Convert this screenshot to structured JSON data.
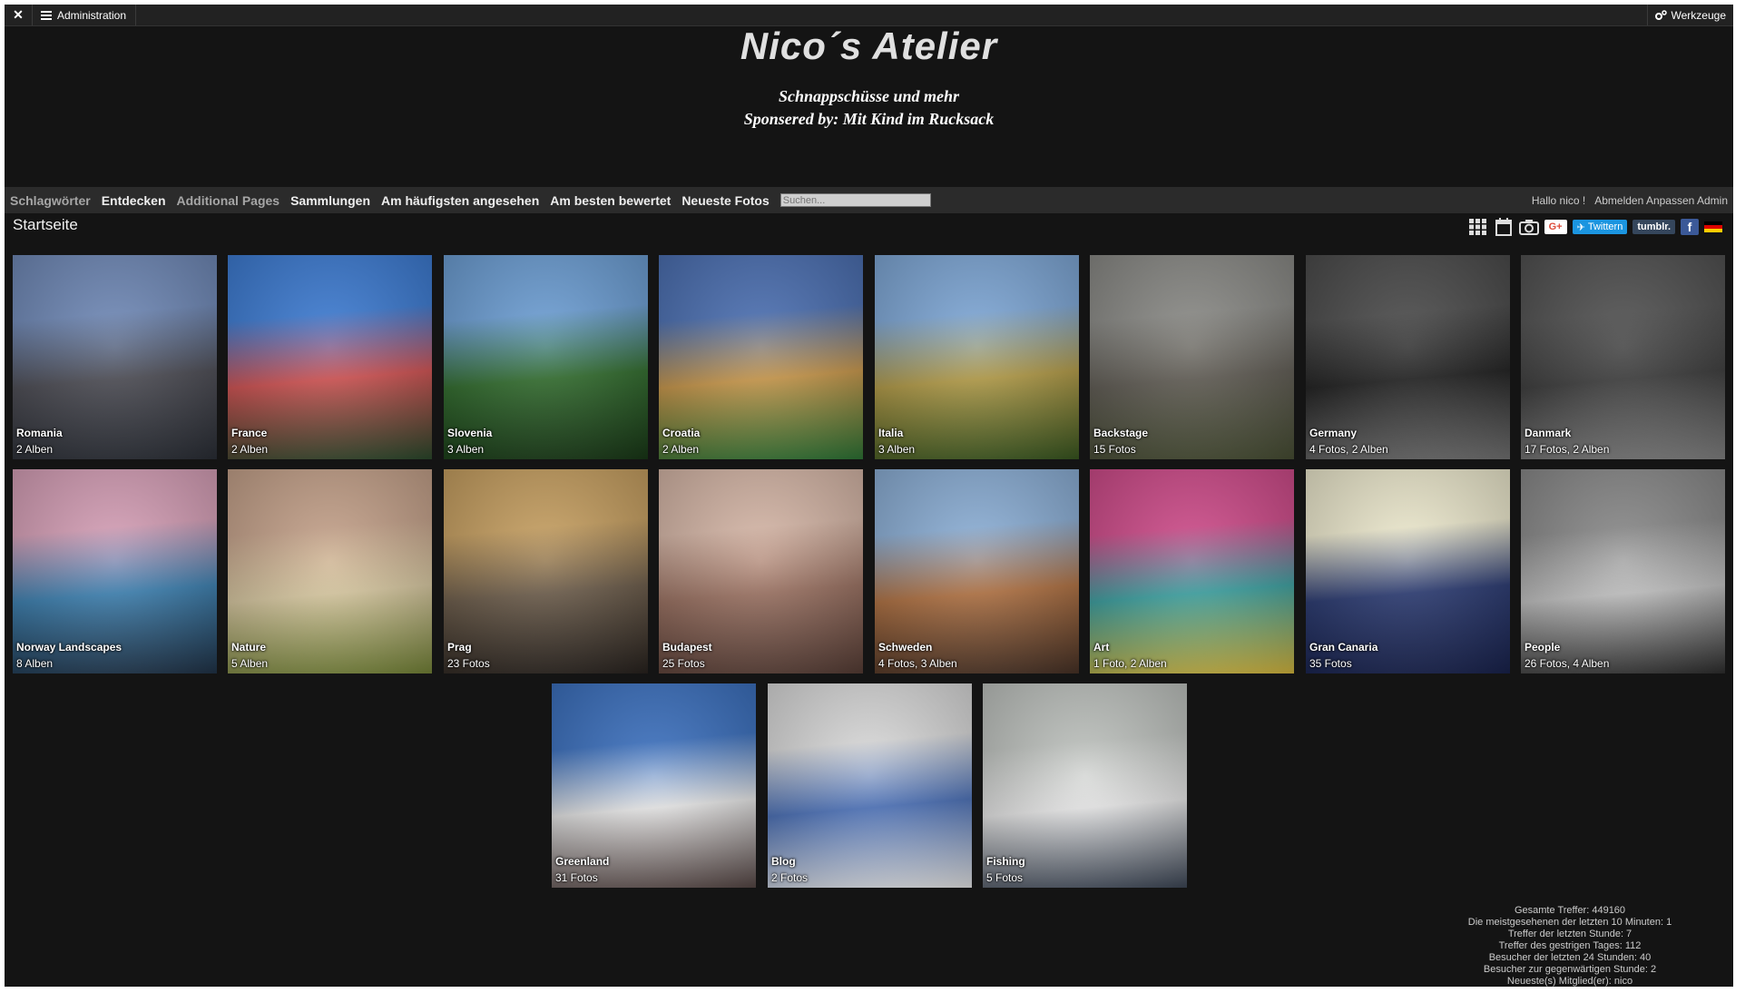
{
  "adminbar": {
    "close_label": "✕",
    "admin_label": "Administration",
    "tools_label": "Werkzeuge"
  },
  "header": {
    "title": "Nico´s Atelier",
    "subtitle_line1": "Schnappschüsse und mehr",
    "subtitle_line2": "Sponsered by: Mit Kind im Rucksack"
  },
  "menu": {
    "items": [
      {
        "label": "Schlagwörter",
        "dim": true
      },
      {
        "label": "Entdecken",
        "dim": false
      },
      {
        "label": "Additional Pages",
        "dim": true
      },
      {
        "label": "Sammlungen",
        "dim": false
      },
      {
        "label": "Am häufigsten angesehen",
        "dim": false
      },
      {
        "label": "Am besten bewertet",
        "dim": false
      },
      {
        "label": "Neueste Fotos",
        "dim": false
      }
    ],
    "search_placeholder": "Suchen...",
    "greeting": "Hallo nico !",
    "user_links": "Abmelden Anpassen Admin"
  },
  "page": {
    "title": "Startseite"
  },
  "toolbar": {
    "gplus": "G+",
    "twitter": "Twittern",
    "tumblr": "tumblr.",
    "facebook": "f"
  },
  "albums": [
    {
      "name": "Romania",
      "count": "2 Alben",
      "colors": [
        "#6f89b8",
        "#4a4a52",
        "#2c3038"
      ]
    },
    {
      "name": "France",
      "count": "2 Alben",
      "colors": [
        "#3b7bd4",
        "#d05050",
        "#2d4d2e"
      ]
    },
    {
      "name": "Slovenia",
      "count": "3 Alben",
      "colors": [
        "#6c9fd6",
        "#2f6b2b",
        "#1a3a18"
      ]
    },
    {
      "name": "Croatia",
      "count": "2 Alben",
      "colors": [
        "#4a6fb3",
        "#c89648",
        "#2f7a38"
      ]
    },
    {
      "name": "Italia",
      "count": "3 Alben",
      "colors": [
        "#7ea8d8",
        "#b29a45",
        "#3b5b22"
      ]
    },
    {
      "name": "Backstage",
      "count": "15 Fotos",
      "colors": [
        "#8a8a86",
        "#5e5a52",
        "#4b5236"
      ]
    },
    {
      "name": "Germany",
      "count": "4 Fotos, 2 Alben",
      "colors": [
        "#4a4a4a",
        "#1e1e1e",
        "#7a7a7a"
      ]
    },
    {
      "name": "Danmark",
      "count": "17 Fotos, 2 Alben",
      "colors": [
        "#505050",
        "#3a3a3a",
        "#8a8a8a"
      ]
    },
    {
      "name": "Norway Landscapes",
      "count": "8 Alben",
      "colors": [
        "#d8a0b8",
        "#3a7fb0",
        "#22354a"
      ]
    },
    {
      "name": "Nature",
      "count": "5 Alben",
      "colors": [
        "#c6a28a",
        "#d8c8a0",
        "#7a8a3a"
      ]
    },
    {
      "name": "Prag",
      "count": "23 Fotos",
      "colors": [
        "#c8a060",
        "#6a5a48",
        "#2a2420"
      ]
    },
    {
      "name": "Budapest",
      "count": "25 Fotos",
      "colors": [
        "#d8b8a8",
        "#9a7060",
        "#5a4038"
      ]
    },
    {
      "name": "Schweden",
      "count": "4 Fotos, 3 Alben",
      "colors": [
        "#8cb0d8",
        "#b07040",
        "#4a3428"
      ]
    },
    {
      "name": "Art",
      "count": "1 Foto, 2 Alben",
      "colors": [
        "#d04a8a",
        "#3aa0a0",
        "#e0c040"
      ]
    },
    {
      "name": "Gran Canaria",
      "count": "35 Fotos",
      "colors": [
        "#f0ecd0",
        "#283870",
        "#1a2450"
      ]
    },
    {
      "name": "People",
      "count": "26 Fotos, 4 Alben",
      "colors": [
        "#8a8a8a",
        "#c0c0c0",
        "#303030"
      ]
    },
    {
      "name": "Greenland",
      "count": "31 Fotos",
      "colors": [
        "#3a70c0",
        "#e8e8e8",
        "#5a4a48"
      ]
    },
    {
      "name": "Blog",
      "count": "2 Fotos",
      "colors": [
        "#dcdcdc",
        "#4a70b8",
        "#f4f4f4"
      ]
    },
    {
      "name": "Fishing",
      "count": "5 Fotos",
      "colors": [
        "#c0c4c0",
        "#e8e8e8",
        "#404a5a"
      ]
    }
  ],
  "stats": [
    "Gesamte Treffer: 449160",
    "Die meistgesehenen der letzten 10 Minuten: 1",
    "Treffer der letzten Stunde: 7",
    "Treffer des gestrigen Tages: 112",
    "Besucher der letzten 24 Stunden: 40",
    "Besucher zur gegenwärtigen Stunde: 2",
    "Neueste(s) Mitglied(er): nico"
  ]
}
